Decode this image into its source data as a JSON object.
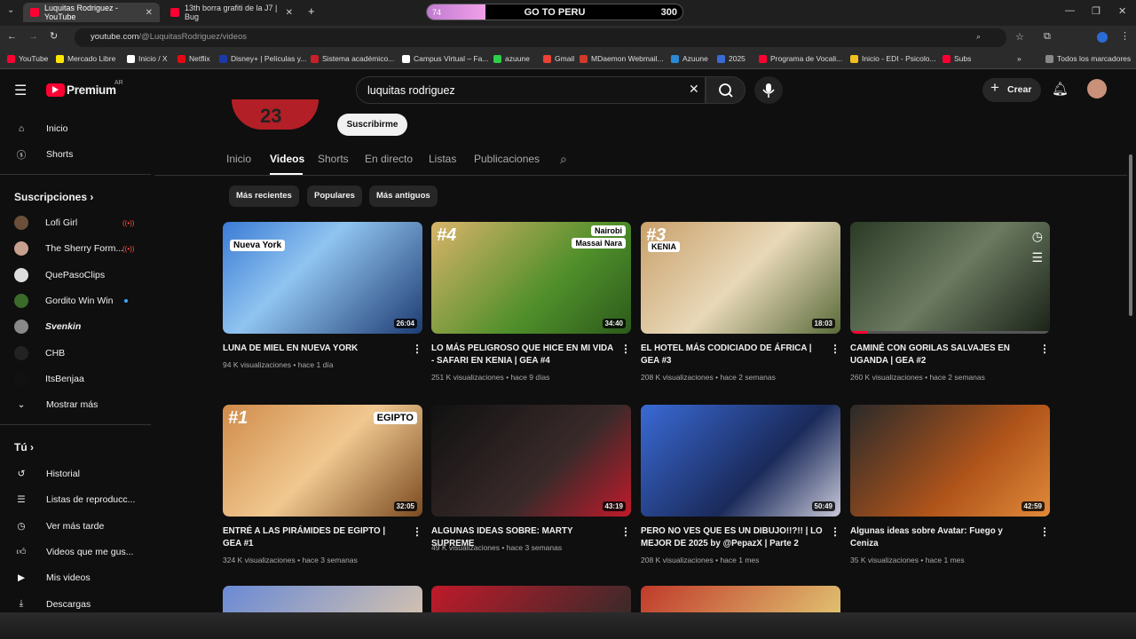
{
  "browser": {
    "tabs": [
      {
        "title": "Luquitas Rodriguez - YouTube"
      },
      {
        "title": "13th borra grafiti de la J7 | Bug"
      }
    ],
    "goal": {
      "label": "GO TO PERU",
      "count": "300",
      "progress_label": "74",
      "progress": 0.23
    },
    "url_host": "youtube.com",
    "url_path": "/@LuquitasRodriguez/videos",
    "bookmarks": [
      "YouTube",
      "Mercado Libre",
      "Inicio / X",
      "Netflix",
      "Disney+ | Películas y...",
      "Sistema académico...",
      "Campus Virtual – Fa...",
      "azuune",
      "Gmail",
      "MDaemon Webmail...",
      "Azuune",
      "2025",
      "Programa de Vocali...",
      "Inicio - EDI - Psicolo...",
      "Subs"
    ],
    "bookmarks_all": "Todos los marcadores"
  },
  "youtube": {
    "logo": "Premium",
    "region": "AR",
    "search_value": "luquitas rodriguez",
    "create_label": "Crear"
  },
  "sidebar": {
    "main": [
      "Inicio",
      "Shorts"
    ],
    "subs_heading": "Suscripciones",
    "subs": [
      {
        "name": "Lofi Girl",
        "status": "live",
        "color": "#6b4f3a"
      },
      {
        "name": "The Sherry Form...",
        "status": "live",
        "color": "#c8a090"
      },
      {
        "name": "QuePasoClips",
        "status": "",
        "color": "#ddd"
      },
      {
        "name": "Gordito Win Win",
        "status": "new",
        "color": "#3a6b2a"
      },
      {
        "name": "Svenkin",
        "status": "",
        "color": "#888"
      },
      {
        "name": "CHB",
        "status": "",
        "color": "#222"
      },
      {
        "name": "ItsBenjaa",
        "status": "",
        "color": "#111"
      }
    ],
    "show_more": "Mostrar más",
    "you_heading": "Tú",
    "you": [
      "Historial",
      "Listas de reproducc...",
      "Ver más tarde",
      "Videos que me gus...",
      "Mis videos",
      "Descargas"
    ]
  },
  "channel": {
    "avatar_text": "23",
    "subscribe": "Suscribirme",
    "tabs": [
      "Inicio",
      "Videos",
      "Shorts",
      "En directo",
      "Listas",
      "Publicaciones"
    ],
    "chips": [
      "Más recientes",
      "Populares",
      "Más antiguos"
    ]
  },
  "videos": [
    {
      "title": "LUNA DE MIEL EN NUEVA YORK",
      "views": "94 K visualizaciones",
      "age": "hace 1 día",
      "duration": "26:04",
      "tag": "Nueva York",
      "num": "",
      "bg": "linear-gradient(135deg,#3a7bd5,#90c4f0 40%,#1e3c72)"
    },
    {
      "title": "LO MÁS PELIGROSO QUE HICE EN MI VIDA - SAFARI EN KENIA | GEA #4",
      "views": "251 K visualizaciones",
      "age": "hace 9 días",
      "duration": "34:40",
      "tag": "Nairobi",
      "tag2": "Massai Nara",
      "num": "#4",
      "bg": "linear-gradient(135deg,#d9b46a,#4f8f2a 60%,#2c5a1a)"
    },
    {
      "title": "EL HOTEL MÁS CODICIADO DE ÁFRICA | GEA #3",
      "views": "208 K visualizaciones",
      "age": "hace 2 semanas",
      "duration": "18:03",
      "tag": "KENIA",
      "num": "#3",
      "bg": "linear-gradient(135deg,#c9a06a,#e8d8b8 50%,#5a6b3a)"
    },
    {
      "title": "CAMINÉ CON GORILAS SALVAJES EN UGANDA | GEA #2",
      "views": "260 K visualizaciones",
      "age": "hace 2 semanas",
      "duration": "",
      "tag": "",
      "num": "",
      "bg": "linear-gradient(135deg,#2a3a25,#6b7a60 50%,#1a2218)"
    },
    {
      "title": "ENTRÉ A LAS PIRÁMIDES DE EGIPTO | GEA #1",
      "views": "324 K visualizaciones",
      "age": "hace 3 semanas",
      "duration": "32:05",
      "tag": "EGIPTO",
      "num": "#1",
      "bg": "linear-gradient(135deg,#d08b4a,#f0c890 50%,#7a4a20)"
    },
    {
      "title": "ALGUNAS IDEAS SOBRE: MARTY SUPREME",
      "views": "49 K visualizaciones",
      "age": "hace 3 semanas",
      "duration": "43:19",
      "tag": "",
      "num": "",
      "bg": "linear-gradient(135deg,#111,#3a2a2a 60%,#c01a2a)"
    },
    {
      "title": "PERO NO VES QUE ES UN DIBUJO!!?!! | LO MEJOR DE 2025 by @PepazX | Parte 2",
      "views": "208 K visualizaciones",
      "age": "hace 1 mes",
      "duration": "50:49",
      "tag": "",
      "num": "",
      "bg": "linear-gradient(135deg,#3a6ad5,#1a2a5a 60%,#c8c8d8)"
    },
    {
      "title": "Algunas ideas sobre Avatar: Fuego y Ceniza",
      "views": "35 K visualizaciones",
      "age": "hace 1 mes",
      "duration": "42:59",
      "tag": "",
      "num": "",
      "bg": "linear-gradient(135deg,#2a2a2a,#b0541a 60%,#e08a3a)"
    }
  ]
}
